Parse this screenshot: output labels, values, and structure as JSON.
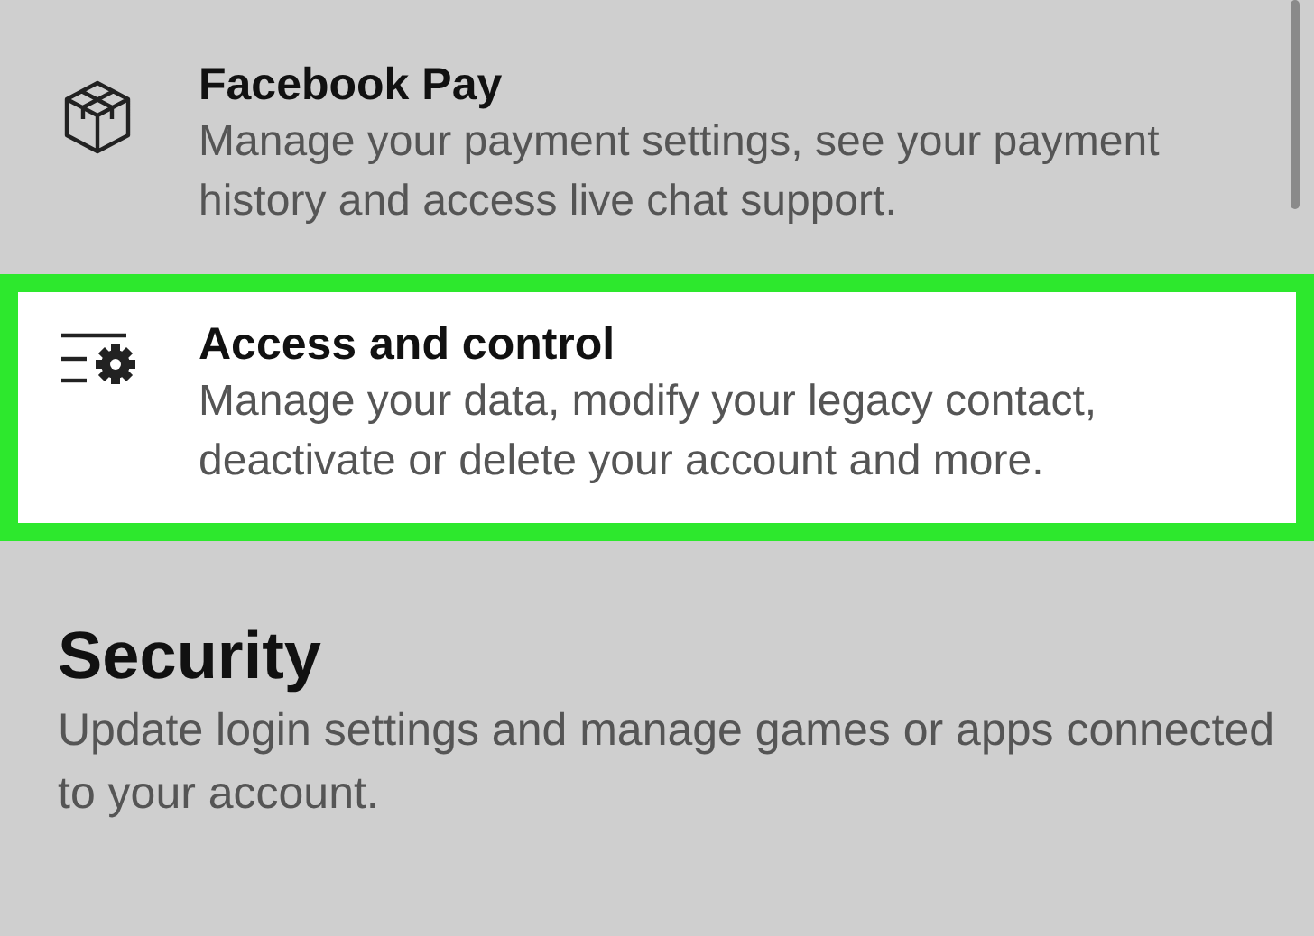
{
  "menu_items": [
    {
      "kind": "box",
      "title": "Facebook Pay",
      "description": "Manage your payment settings, see your payment history and access live chat support.",
      "highlighted": false
    },
    {
      "kind": "settings",
      "title": "Access and control",
      "description": "Manage your data, modify your legacy contact, deactivate or delete your account and more.",
      "highlighted": true
    }
  ],
  "section": {
    "title": "Security",
    "description": "Update login settings and manage games or apps connected to your account."
  }
}
